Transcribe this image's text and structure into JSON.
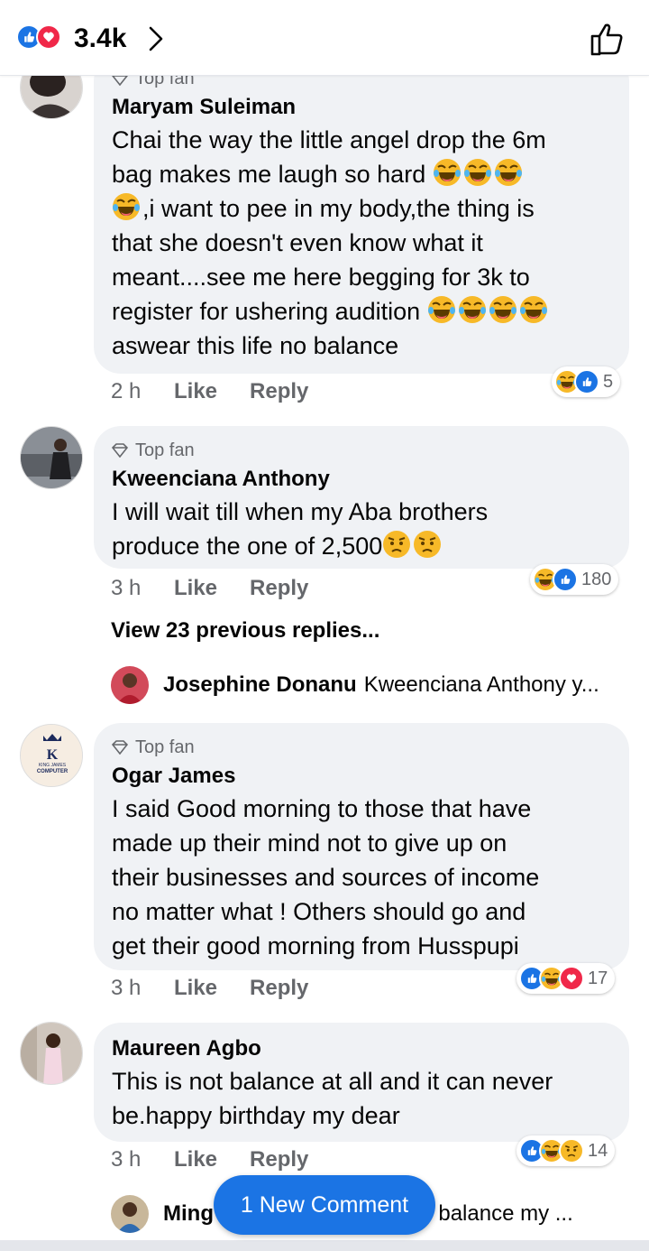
{
  "header": {
    "reaction_count": "3.4k"
  },
  "comments": [
    {
      "badge": "Top fan",
      "name": "Maryam Suleiman",
      "lines": [
        "Chai the way the little angel drop the 6m",
        "bag makes me laugh so hard",
        ",i want to pee in my body,the thing is",
        "that she doesn't even know what it",
        "meant....see me here begging for 3k to",
        "register for ushering audition",
        "aswear this life no balance"
      ],
      "time": "2 h",
      "like": "Like",
      "reply": "Reply",
      "reaction_count": "5"
    },
    {
      "badge": "Top fan",
      "name": "Kweenciana Anthony",
      "lines": [
        "I will wait till when my Aba brothers",
        "produce the one of 2,500"
      ],
      "time": "3 h",
      "like": "Like",
      "reply": "Reply",
      "reaction_count": "180"
    },
    {
      "badge": "Top fan",
      "name": "Ogar James",
      "lines": [
        "I said Good morning to those that have",
        "made up their mind not to give up on",
        "their businesses and sources of income",
        "no matter what ! Others should go and",
        "get their good morning from Husspupi"
      ],
      "time": "3 h",
      "like": "Like",
      "reply": "Reply",
      "reaction_count": "17",
      "avatar_logo": {
        "line1": "K",
        "line2": "KING JAMES",
        "line3": "COMPUTER"
      }
    },
    {
      "badge": "",
      "name": "Maureen Agbo",
      "lines": [
        "This is not balance at all and it can never",
        "be.happy birthday my dear"
      ],
      "time": "3 h",
      "like": "Like",
      "reply": "Reply",
      "reaction_count": "14"
    }
  ],
  "thread": {
    "view_previous": "View 23 previous replies...",
    "reply_name": "Josephine Donanu",
    "reply_text": "Kweenciana Anthony y...",
    "bottom_name": "Ming",
    "bottom_text": "er be balance my ..."
  },
  "new_comment_label": "1 New Comment",
  "colors": {
    "like_blue": "#1b74e4",
    "love_red": "#f02849",
    "haha_yellow": "#f7b928",
    "bubble_bg": "#f0f2f5",
    "meta_gray": "#65676b"
  }
}
